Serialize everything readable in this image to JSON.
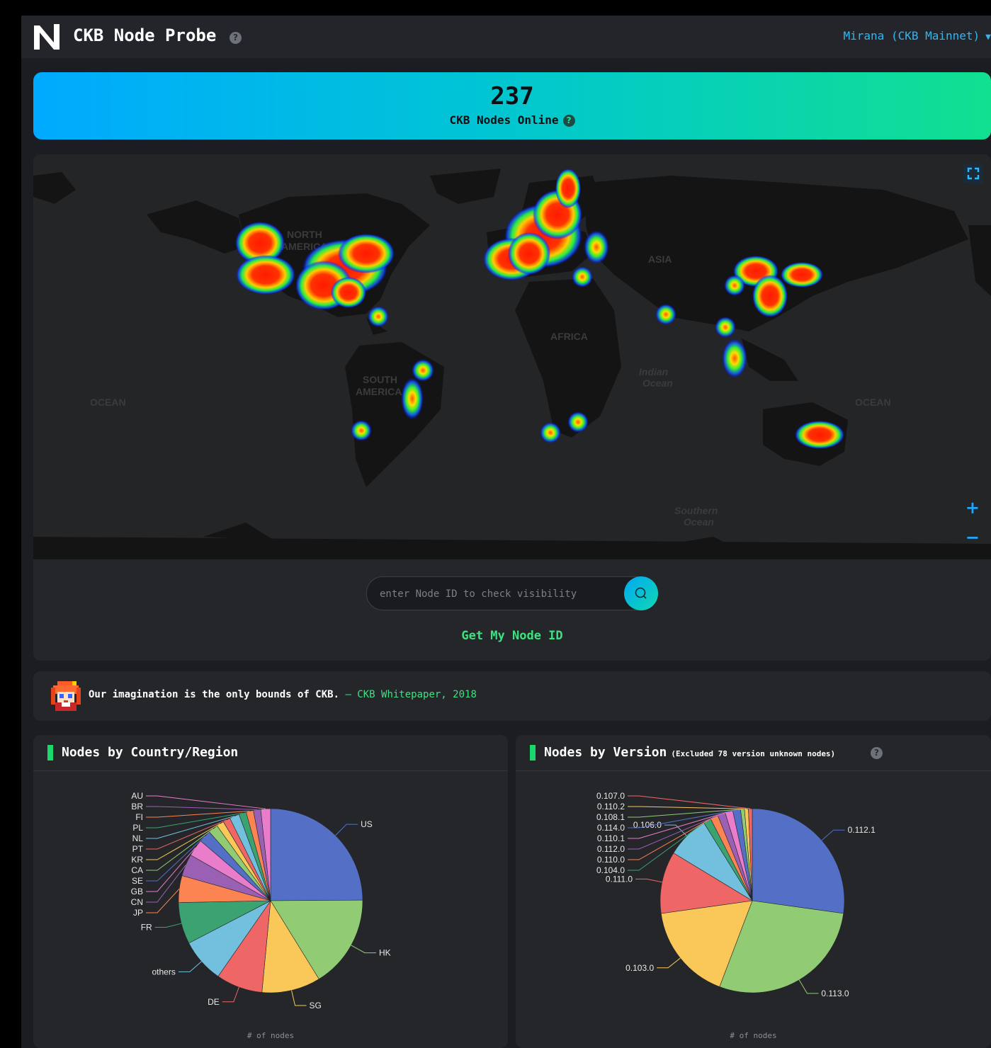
{
  "app": {
    "title": "CKB Node Probe",
    "network_label": "Mirana (CKB Mainnet)",
    "help_glyph": "?"
  },
  "banner": {
    "count": "237",
    "label": "CKB Nodes Online"
  },
  "map": {
    "labels": [
      {
        "text": "NORTH",
        "kind": "continent"
      },
      {
        "text": "AMERICA",
        "kind": "continent"
      },
      {
        "text": "SOUTH",
        "kind": "continent"
      },
      {
        "text": "AMERICA",
        "kind": "continent"
      },
      {
        "text": "AFRICA",
        "kind": "continent"
      },
      {
        "text": "ASIA",
        "kind": "continent"
      },
      {
        "text": "OCEAN",
        "kind": "ocean"
      },
      {
        "text": "OCEAN",
        "kind": "ocean"
      },
      {
        "text": "Indian",
        "kind": "ocean-italic"
      },
      {
        "text": "Ocean",
        "kind": "ocean-italic"
      },
      {
        "text": "Southern",
        "kind": "ocean-italic"
      },
      {
        "text": "Ocean",
        "kind": "ocean-italic"
      }
    ],
    "zoom_in": "+",
    "zoom_out": "−"
  },
  "search": {
    "placeholder": "enter Node ID to check visibility",
    "get_id_label": "Get My Node ID"
  },
  "quote": {
    "text": "Our imagination is the only bounds of CKB.",
    "source": " – CKB Whitepaper, 2018"
  },
  "country_chart": {
    "title": "Nodes by Country/Region",
    "axis_note": "# of nodes"
  },
  "version_chart": {
    "title": "Nodes by Version",
    "subtitle": "(Excluded 78 version unknown nodes)",
    "axis_note": "# of nodes"
  },
  "chart_data": [
    {
      "type": "pie",
      "title": "Nodes by Country/Region",
      "xlabel": "# of nodes",
      "categories": [
        "US",
        "HK",
        "SG",
        "DE",
        "others",
        "FR",
        "JP",
        "CN",
        "GB",
        "SE",
        "CA",
        "KR",
        "PT",
        "NL",
        "PL",
        "FI",
        "BR",
        "AU"
      ],
      "values": [
        58,
        38,
        24,
        19,
        18,
        17,
        11,
        9,
        7,
        5,
        4,
        3,
        3,
        4,
        3,
        3,
        3,
        4
      ],
      "colors": [
        "#5470c6",
        "#91cc75",
        "#fac858",
        "#ee6666",
        "#73c0de",
        "#3ba272",
        "#fc8452",
        "#9a60b4",
        "#ea7ccc",
        "#5470c6",
        "#91cc75",
        "#fac858",
        "#ee6666",
        "#73c0de",
        "#3ba272",
        "#fc8452",
        "#9a60b4",
        "#ea7ccc"
      ]
    },
    {
      "type": "pie",
      "title": "Nodes by Version",
      "xlabel": "# of nodes",
      "categories": [
        "0.112.1",
        "0.113.0",
        "0.103.0",
        "0.111.0",
        "0.106.0",
        "0.104.0",
        "0.110.0",
        "0.112.0",
        "0.110.1",
        "0.114.0",
        "0.108.1",
        "0.110.2",
        "0.107.0"
      ],
      "values": [
        40,
        42,
        25,
        16,
        11,
        2,
        2,
        2,
        2,
        2,
        1,
        1,
        1
      ],
      "colors": [
        "#5470c6",
        "#91cc75",
        "#fac858",
        "#ee6666",
        "#73c0de",
        "#3ba272",
        "#fc8452",
        "#9a60b4",
        "#ea7ccc",
        "#5470c6",
        "#91cc75",
        "#fac858",
        "#ee6666"
      ]
    }
  ]
}
